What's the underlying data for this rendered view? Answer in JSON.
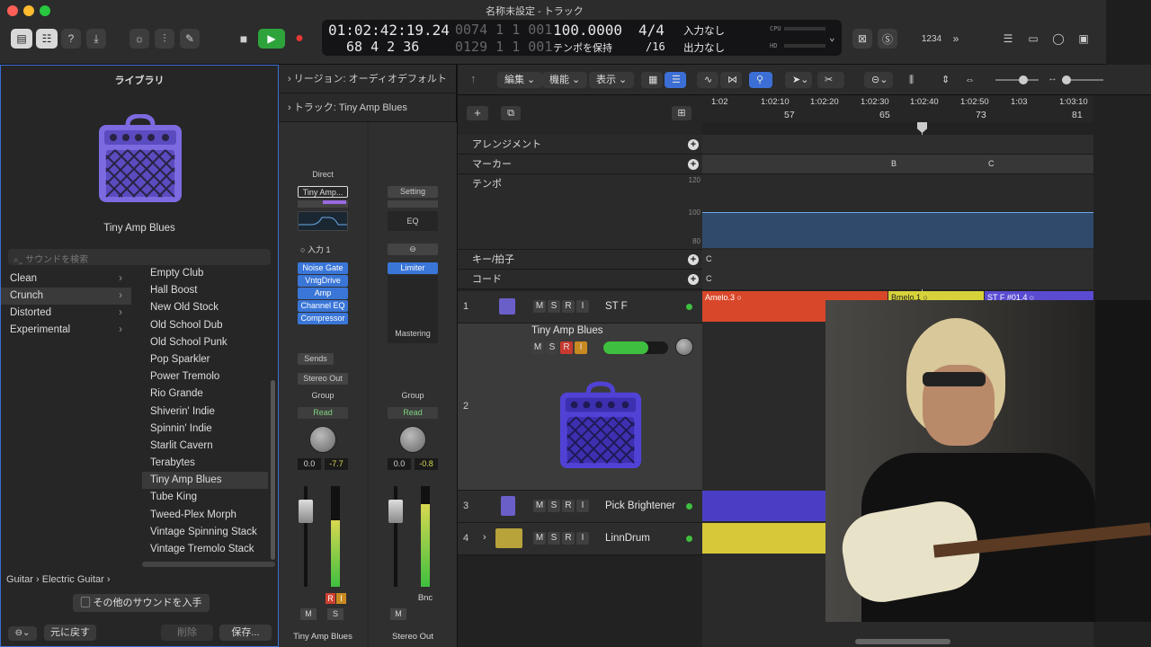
{
  "window": {
    "title": "名称未設定 - トラック"
  },
  "lcd": {
    "time": "01:02:42:19.24",
    "bars_a": "0074 1 1 001",
    "bars": "68  4  2  36",
    "bars_b": "0129 1 1 001",
    "tempo": "100.0000",
    "tempo_mode": "テンポを保持",
    "sig": "4/4",
    "div": "/16",
    "in": "入力なし",
    "out": "出力なし",
    "cpu": "CPU",
    "hd": "HD"
  },
  "counter": "1234",
  "library": {
    "title": "ライブラリ",
    "patch_name": "Tiny Amp Blues",
    "search_placeholder": "サウンドを検索",
    "categories": [
      "Clean",
      "Crunch",
      "Distorted",
      "Experimental"
    ],
    "patches": [
      "Empty Club",
      "Hall Boost",
      "New Old Stock",
      "Old School Dub",
      "Old School Punk",
      "Pop Sparkler",
      "Power Tremolo",
      "Rio Grande",
      "Shiverin' Indie",
      "Spinnin' Indie",
      "Starlit Cavern",
      "Terabytes",
      "Tiny Amp Blues",
      "Tube King",
      "Tweed-Plex Morph",
      "Vintage Spinning Stack",
      "Vintage Tremolo Stack"
    ],
    "breadcrumb": "Guitar › Electric Guitar ›",
    "get_more": "その他のサウンドを入手",
    "revert": "元に戻す",
    "delete": "削除",
    "save": "保存..."
  },
  "inspector": {
    "region": "リージョン: オーディオデフォルト",
    "track": "トラック:  Tiny Amp Blues"
  },
  "strip1": {
    "direct": "Direct",
    "setting": "Tiny Amp...",
    "input": "入力 1",
    "plugins": [
      "Noise Gate",
      "VntgDrive",
      "Amp",
      "Channel EQ",
      "Compressor"
    ],
    "sends": "Sends",
    "output": "Stereo Out",
    "group": "Group",
    "auto": "Read",
    "pan": "0.0",
    "level": "-7.7",
    "rec": "R",
    "inp": "I",
    "mute": "M",
    "solo": "S",
    "name": "Tiny Amp Blues"
  },
  "strip2": {
    "setting": "Setting",
    "eq": "EQ",
    "plugins": [
      "Limiter"
    ],
    "mastering": "Mastering",
    "group": "Group",
    "auto": "Read",
    "pan": "0.0",
    "level": "-0.8",
    "bnc": "Bnc",
    "mute": "M",
    "name": "Stereo Out"
  },
  "menus": [
    "編集",
    "機能",
    "表示"
  ],
  "ruler": {
    "times": [
      "1:02",
      "1:02:10",
      "1:02:20",
      "1:02:30",
      "1:02:40",
      "1:02:50",
      "1:03",
      "1:03:10"
    ],
    "bars": [
      "57",
      "65",
      "73",
      "81"
    ]
  },
  "globals": {
    "arrangement": "アレンジメント",
    "marker": "マーカー",
    "tempo": "テンポ",
    "key": "キー/拍子",
    "chord": "コード",
    "tempo_scale": [
      "120",
      "100",
      "80"
    ],
    "markers": [
      "B",
      "C"
    ],
    "key_val": "C",
    "chord_val": "C"
  },
  "tracks": [
    {
      "num": "1",
      "name": "ST F"
    },
    {
      "num": "2",
      "name": "Tiny Amp Blues"
    },
    {
      "num": "3",
      "name": "Pick Brightener"
    },
    {
      "num": "4",
      "name": "LinnDrum"
    }
  ],
  "regions": [
    "Amelo.3",
    "Bmelo.1",
    "ST F #01.4"
  ],
  "colors": {
    "accent": "#3b6fd6",
    "amp": "#7c6ae0",
    "region_red": "#d9472a",
    "region_yellow": "#d7d23a",
    "region_purple": "#5a4bd1"
  }
}
